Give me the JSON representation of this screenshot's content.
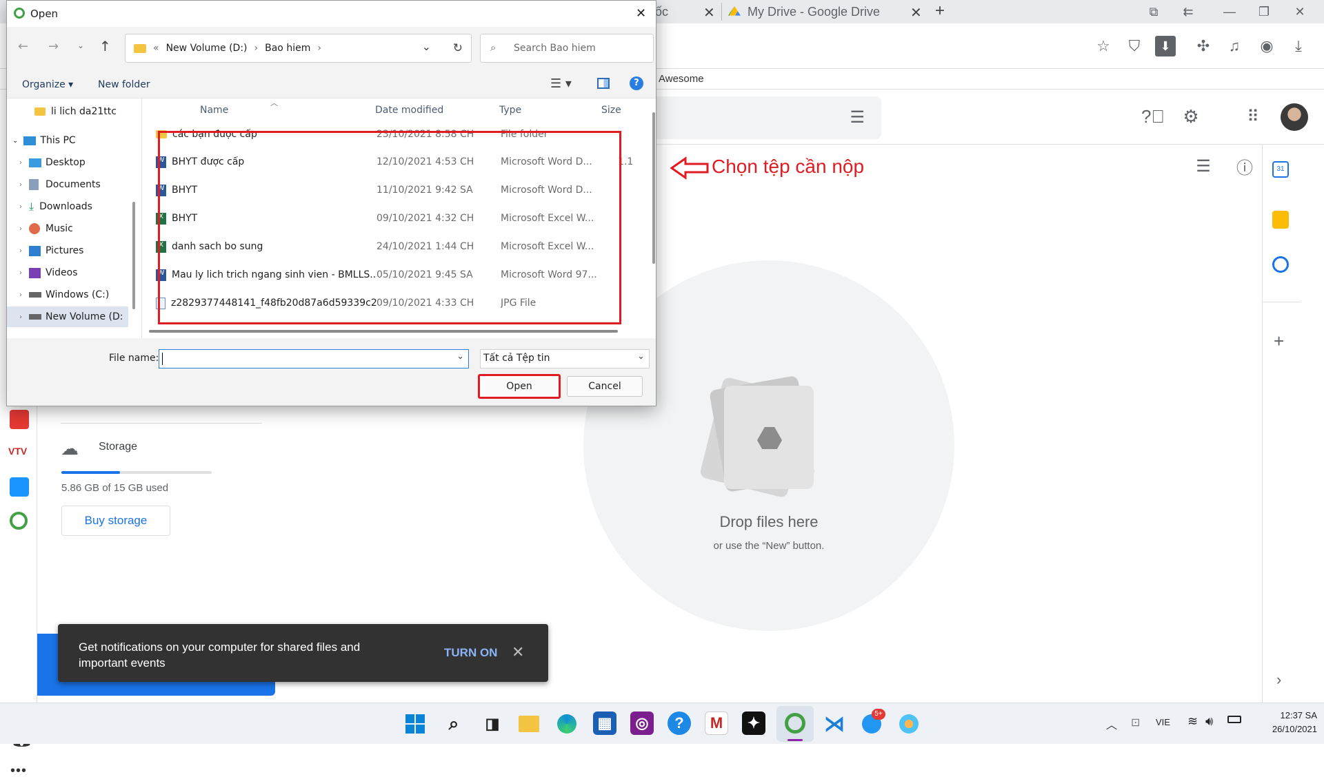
{
  "browser": {
    "tabs": [
      {
        "label": "ốc"
      },
      {
        "label": "My Drive - Google Drive"
      }
    ],
    "new_tab": "+",
    "bookmark": "Awesome"
  },
  "drive": {
    "storage_label": "Storage",
    "storage_used": "5.86 GB of 15 GB used",
    "storage_fraction": 0.39,
    "buy_storage": "Buy storage",
    "drop_title": "Drop files here",
    "drop_sub": "or use the “New” button.",
    "notification_text": "Get notifications on your computer for shared files and important events",
    "notification_action": "TURN ON"
  },
  "annotation": {
    "text": "Chọn tệp cần nộp",
    "color": "#e11b22"
  },
  "dialog": {
    "title": "Open",
    "breadcrumb": [
      "«",
      "New Volume (D:)",
      "Bao hiem"
    ],
    "search_placeholder": "Search Bao hiem",
    "organize": "Organize",
    "new_folder": "New folder",
    "help": "?",
    "nav_items": [
      {
        "label": "li lich da21ttc",
        "icon": "folder-icon"
      },
      {
        "label": "This PC",
        "icon": "pc-icon"
      },
      {
        "label": "Desktop",
        "icon": "desktop-icon"
      },
      {
        "label": "Documents",
        "icon": "documents-icon"
      },
      {
        "label": "Downloads",
        "icon": "downloads-icon"
      },
      {
        "label": "Music",
        "icon": "music-icon"
      },
      {
        "label": "Pictures",
        "icon": "pictures-icon"
      },
      {
        "label": "Videos",
        "icon": "videos-icon"
      },
      {
        "label": "Windows (C:)",
        "icon": "drive-icon"
      },
      {
        "label": "New Volume (D:",
        "icon": "drive-icon"
      }
    ],
    "columns": {
      "name": "Name",
      "date": "Date modified",
      "type": "Type",
      "size": "Size"
    },
    "files": [
      {
        "name": "các bạn được cấp",
        "date": "23/10/2021 8:58 CH",
        "type": "File folder",
        "size": "",
        "icon": "folder-icon"
      },
      {
        "name": "BHYT được cấp",
        "date": "12/10/2021 4:53 CH",
        "type": "Microsoft Word D...",
        "size": "1.1",
        "icon": "word-icon"
      },
      {
        "name": "BHYT",
        "date": "11/10/2021 9:42 SA",
        "type": "Microsoft Word D...",
        "size": "",
        "icon": "word-icon"
      },
      {
        "name": "BHYT",
        "date": "09/10/2021 4:32 CH",
        "type": "Microsoft Excel W...",
        "size": "",
        "icon": "excel-icon"
      },
      {
        "name": "danh sach bo sung",
        "date": "24/10/2021 1:44 CH",
        "type": "Microsoft Excel W...",
        "size": "",
        "icon": "excel-icon"
      },
      {
        "name": "Mau ly lich trich ngang sinh vien - BMLLS...",
        "date": "05/10/2021 9:45 SA",
        "type": "Microsoft Word 97...",
        "size": "",
        "icon": "word-icon"
      },
      {
        "name": "z2829377448141_f48fb20d87a6d59339c2...",
        "date": "09/10/2021 4:33 CH",
        "type": "JPG File",
        "size": "",
        "icon": "image-icon"
      }
    ],
    "file_name_label": "File name:",
    "file_name_value": "",
    "file_type": "Tất cả Tệp tin",
    "open": "Open",
    "cancel": "Cancel"
  },
  "taskbar": {
    "language": "VIE",
    "time": "12:37 SA",
    "date": "26/10/2021",
    "zalo_badge": "5+"
  }
}
